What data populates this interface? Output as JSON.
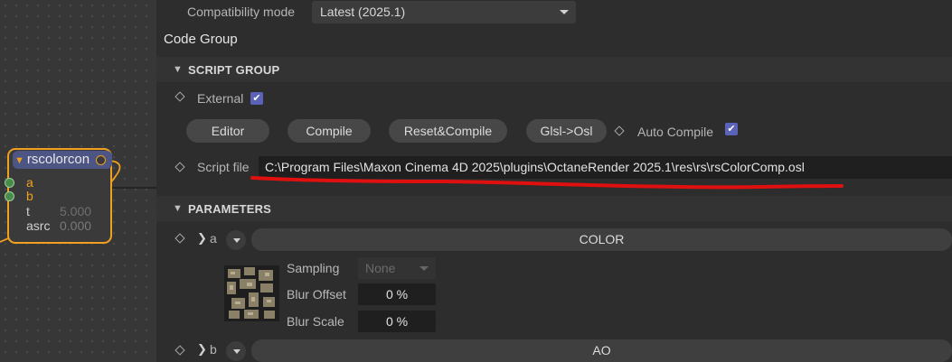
{
  "node": {
    "title": "rscolorcon",
    "ports": [
      {
        "name": "a",
        "value": ""
      },
      {
        "name": "b",
        "value": ""
      },
      {
        "name": "t",
        "value": "5.000"
      },
      {
        "name": "asrc",
        "value": "0.000"
      }
    ]
  },
  "compat": {
    "label": "Compatibility mode",
    "value": "Latest (2025.1)"
  },
  "code_group_label": "Code Group",
  "script_group": {
    "title": "SCRIPT GROUP",
    "external_label": "External",
    "external_checked": true,
    "buttons": [
      "Editor",
      "Compile",
      "Reset&Compile",
      "Glsl->Osl"
    ],
    "auto_compile_label": "Auto Compile",
    "auto_compile_checked": true,
    "script_file_label": "Script file",
    "script_file_path": "C:\\Program Files\\Maxon Cinema 4D 2025\\plugins\\OctaneRender 2025.1\\res\\rs\\rsColorComp.osl",
    "annotation_color": "#e01010"
  },
  "parameters": {
    "title": "PARAMETERS",
    "a": {
      "label": "a",
      "button": "COLOR",
      "sampling_label": "Sampling",
      "sampling_value": "None",
      "blur_offset_label": "Blur Offset",
      "blur_offset_value": "0 %",
      "blur_scale_label": "Blur Scale",
      "blur_scale_value": "0 %"
    },
    "b": {
      "label": "b",
      "button": "AO"
    }
  },
  "colors": {
    "accent": "#5b63b8",
    "node_border": "#f0a020",
    "node_header": "#4d5585"
  }
}
